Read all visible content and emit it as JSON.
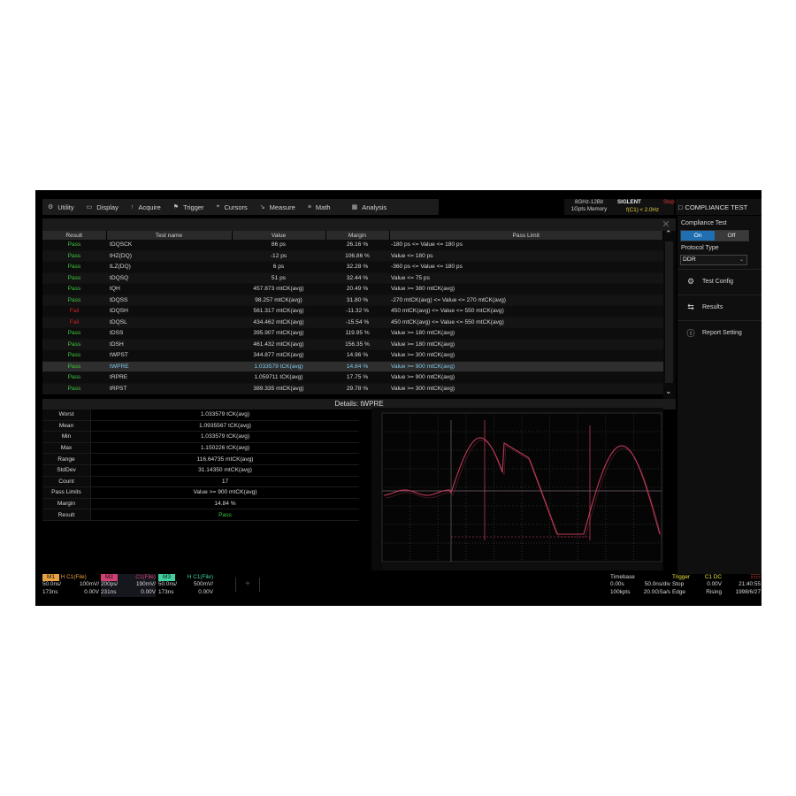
{
  "menu": [
    {
      "label": "Utility",
      "icon": "gear-icon"
    },
    {
      "label": "Display",
      "icon": "monitor-icon"
    },
    {
      "label": "Acquire",
      "icon": "acquire-icon"
    },
    {
      "label": "Trigger",
      "icon": "trigger-flag-icon"
    },
    {
      "label": "Cursors",
      "icon": "cursor-icon"
    },
    {
      "label": "Measure",
      "icon": "ruler-icon"
    },
    {
      "label": "Math",
      "icon": "math-icon"
    },
    {
      "label": "Analysis",
      "icon": "analysis-icon"
    }
  ],
  "hw": {
    "line1": "8GHz-12Bit",
    "line2": "1Gpts Memory"
  },
  "brand": {
    "name": "SIGLENT",
    "stop": "Stop",
    "freq": "f(C1) < 2.0Hz"
  },
  "app_title": "COMPLIANCE TEST",
  "results_headers": [
    "Result",
    "Test name",
    "Value",
    "Margin",
    "Pass Limit"
  ],
  "results": [
    {
      "result": "Pass",
      "name": "tDQSCK",
      "value": "86 ps",
      "margin": "26.16 %",
      "limit": "-180 ps <= Value <= 180 ps"
    },
    {
      "result": "Pass",
      "name": "tHZ(DQ)",
      "value": "-12 ps",
      "margin": "106.86 %",
      "limit": "Value <= 180 ps"
    },
    {
      "result": "Pass",
      "name": "tLZ(DQ)",
      "value": "6 ps",
      "margin": "32.28 %",
      "limit": "-360 ps <= Value <= 180 ps"
    },
    {
      "result": "Pass",
      "name": "tDQSQ",
      "value": "51 ps",
      "margin": "32.44 %",
      "limit": "Value <= 75 ps"
    },
    {
      "result": "Pass",
      "name": "tQH",
      "value": "457.873 mtCK(avg)",
      "margin": "20.49 %",
      "limit": "Value >= 380 mtCK(avg)"
    },
    {
      "result": "Pass",
      "name": "tDQSS",
      "value": "98.257 mtCK(avg)",
      "margin": "31.80 %",
      "limit": "-270 mtCK(avg) <= Value <= 270 mtCK(avg)"
    },
    {
      "result": "Fail",
      "name": "tDQSH",
      "value": "561.317 mtCK(avg)",
      "margin": "-11.32 %",
      "limit": "450 mtCK(avg) <= Value <= 550 mtCK(avg)"
    },
    {
      "result": "Fail",
      "name": "tDQSL",
      "value": "434.462 mtCK(avg)",
      "margin": "-15.54 %",
      "limit": "450 mtCK(avg) <= Value <= 550 mtCK(avg)"
    },
    {
      "result": "Pass",
      "name": "tDSS",
      "value": "395.907 mtCK(avg)",
      "margin": "119.95 %",
      "limit": "Value >= 180 mtCK(avg)"
    },
    {
      "result": "Pass",
      "name": "tDSH",
      "value": "461.432 mtCK(avg)",
      "margin": "156.35 %",
      "limit": "Value >= 180 mtCK(avg)"
    },
    {
      "result": "Pass",
      "name": "tWPST",
      "value": "344.877 mtCK(avg)",
      "margin": "14.96 %",
      "limit": "Value >= 300 mtCK(avg)"
    },
    {
      "result": "Pass",
      "name": "tWPRE",
      "value": "1.033579 tCK(avg)",
      "margin": "14.84 %",
      "limit": "Value >= 900 mtCK(avg)",
      "selected": true
    },
    {
      "result": "Pass",
      "name": "tRPRE",
      "value": "1.059711 tCK(avg)",
      "margin": "17.75 %",
      "limit": "Value >= 900 mtCK(avg)"
    },
    {
      "result": "Pass",
      "name": "tRPST",
      "value": "389.335 mtCK(avg)",
      "margin": "29.78 %",
      "limit": "Value >= 300 mtCK(avg)"
    }
  ],
  "details_title": "Details: tWPRE",
  "details": [
    {
      "label": "Worst",
      "value": "1.033579 tCK(avg)"
    },
    {
      "label": "Mean",
      "value": "1.0935567 tCK(avg)"
    },
    {
      "label": "Min",
      "value": "1.033579 tCK(avg)"
    },
    {
      "label": "Max",
      "value": "1.150226 tCK(avg)"
    },
    {
      "label": "Range",
      "value": "116.64735 mtCK(avg)"
    },
    {
      "label": "StdDev",
      "value": "31.14350 mtCK(avg)"
    },
    {
      "label": "Count",
      "value": "17"
    },
    {
      "label": "Pass Limits",
      "value": "Value >= 900 mtCK(avg)"
    },
    {
      "label": "Margin",
      "value": "14.84 %"
    },
    {
      "label": "Result",
      "value": "Pass"
    }
  ],
  "right_panel": {
    "compliance_label": "Compliance Test",
    "on": "On",
    "off": "Off",
    "protocol_label": "Protocol Type",
    "protocol_value": "DDR",
    "buttons": [
      {
        "label": "Test Config",
        "icon": "test-config-icon"
      },
      {
        "label": "Results",
        "icon": "results-icon"
      },
      {
        "label": "Report Setting",
        "icon": "report-setting-icon"
      }
    ]
  },
  "status": {
    "m1": {
      "tag": "M1",
      "src": "H C1(File)",
      "l1": "50.0ns/",
      "l1b": "100mV/",
      "l2": "173ns",
      "l2b": "0.00V"
    },
    "m2": {
      "tag": "M2",
      "src": "C1(File)",
      "l1": "200ps/",
      "l1b": "190mV/",
      "l2": "231ns",
      "l2b": "0.00V"
    },
    "m3": {
      "tag": "M3",
      "src": "H C1(File)",
      "l1": "50.0ns/",
      "l1b": "500mV/",
      "l2": "173ns",
      "l2b": "0.00V"
    },
    "timebase": {
      "label": "Timebase",
      "a1": "0.00s",
      "a2": "50.0ns/div",
      "b1": "100kpts",
      "b2": "20.0GSa/s"
    },
    "trigger": {
      "label": "Trigger",
      "ch": "C1 DC",
      "a1": "Stop",
      "a2": "0.00V",
      "b1": "Edge",
      "b2": "Rising"
    },
    "clock": {
      "time": "21:40:55",
      "date": "1998/6/27"
    }
  },
  "colors": {
    "m1": "#e8a040",
    "m2": "#d04070",
    "m3": "#40d0a0",
    "wave": "#d04060",
    "pass": "#40c840",
    "fail": "#d02020",
    "accent": "#1f6fb2"
  }
}
